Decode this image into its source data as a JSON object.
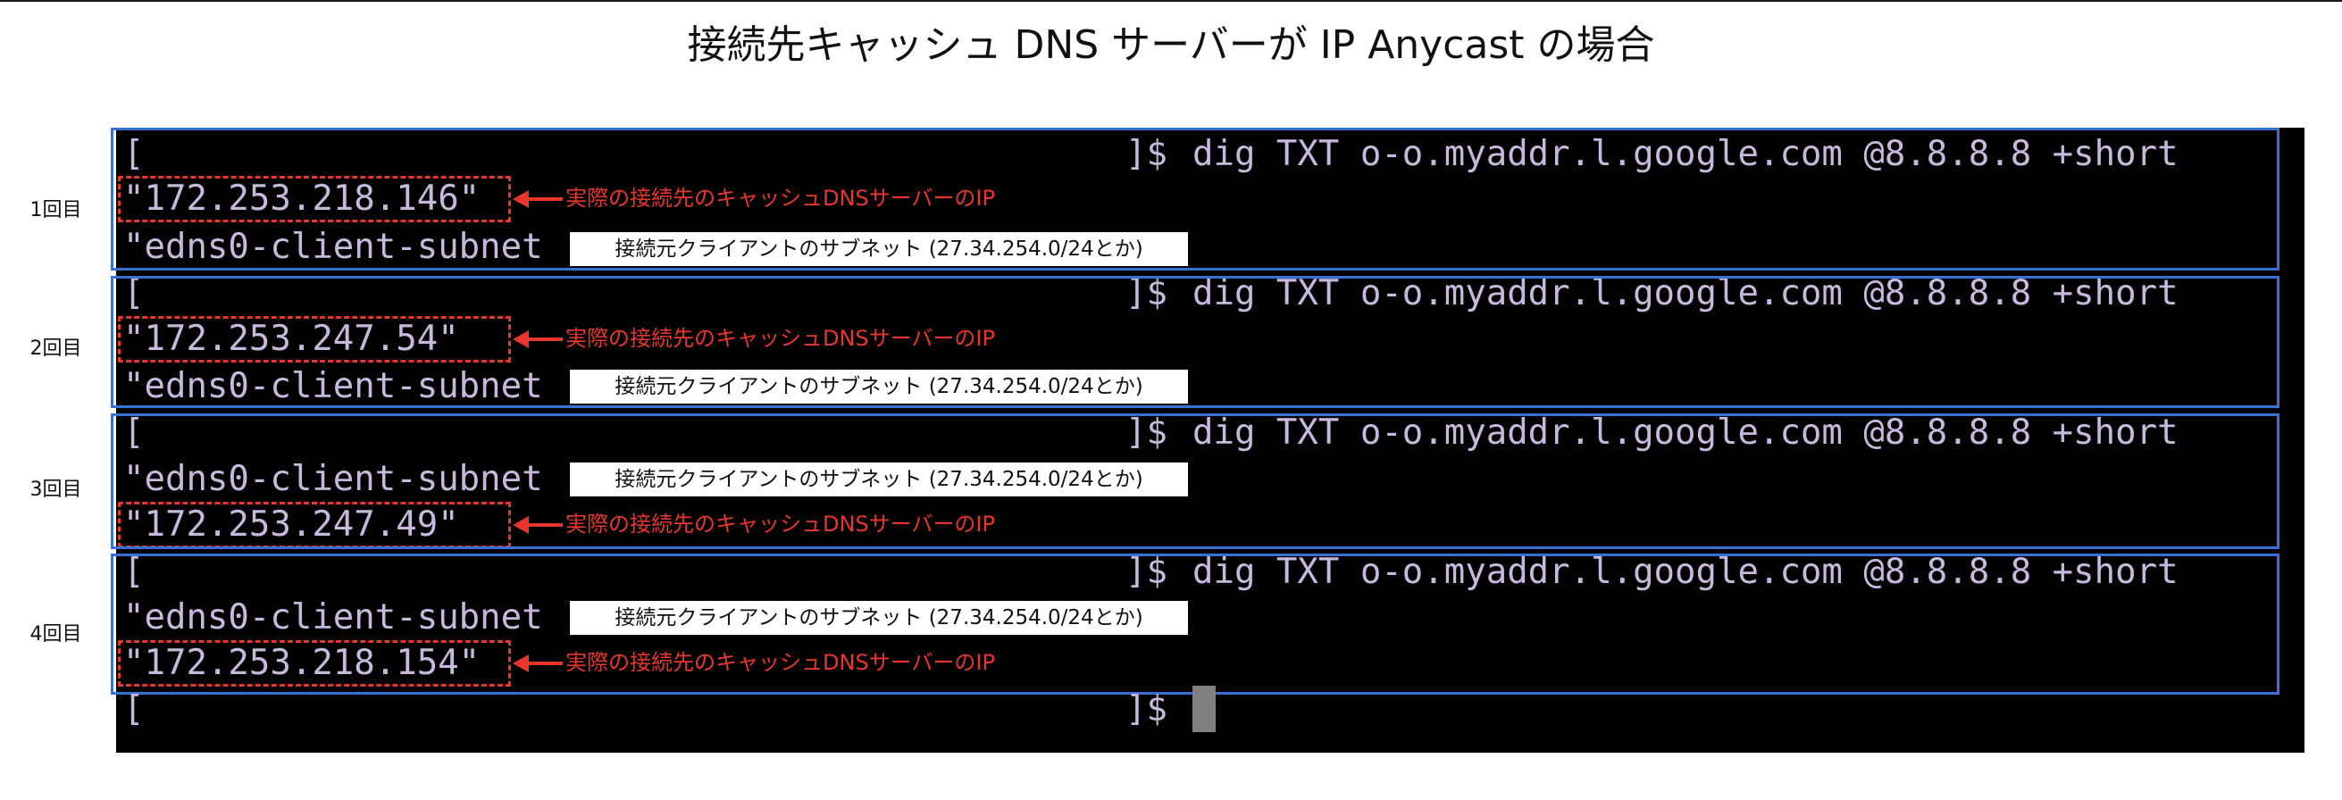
{
  "title": "接続先キャッシュ DNS サーバーが IP Anycast の場合",
  "prompt_open": "[",
  "prompt_close": "]$",
  "command": "dig TXT o-o.myaddr.l.google.com @8.8.8.8 +short",
  "subnet_line": "\"edns0-client-subnet",
  "subnet_label": "接続元クライアントのサブネット (27.34.254.0/24とか)",
  "ip_annotation": "実際の接続先のキャッシュDNSサーバーのIP",
  "runs": [
    {
      "label": "1回目",
      "ip": "\"172.253.218.146\""
    },
    {
      "label": "2回目",
      "ip": "\"172.253.247.54\""
    },
    {
      "label": "3回目",
      "ip": "\"172.253.247.49\""
    },
    {
      "label": "4回目",
      "ip": "\"172.253.218.154\""
    }
  ],
  "colors": {
    "terminal_bg": "#000000",
    "terminal_text": "#c9b8dd",
    "box_blue": "#3a6fd8",
    "annotation_red": "#e8362d"
  }
}
